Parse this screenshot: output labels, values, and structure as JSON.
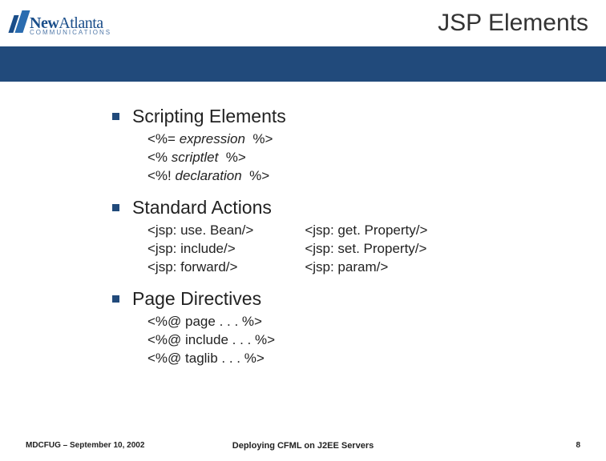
{
  "header": {
    "logo_main_bold": "New",
    "logo_main_light": "Atlanta",
    "logo_sub": "COMMUNICATIONS",
    "title": "JSP Elements"
  },
  "sections": [
    {
      "title": "Scripting Elements",
      "items": [
        {
          "prefix": "<%= ",
          "mid": "expression",
          "suffix": "  %>"
        },
        {
          "prefix": "<% ",
          "mid": "scriptlet",
          "suffix": "  %>"
        },
        {
          "prefix": "<%! ",
          "mid": "declaration",
          "suffix": "  %>"
        }
      ]
    },
    {
      "title": "Standard Actions",
      "col1": [
        "<jsp: use. Bean/>",
        "<jsp: include/>",
        "<jsp: forward/>"
      ],
      "col2": [
        "<jsp: get. Property/>",
        "<jsp: set. Property/>",
        "<jsp: param/>"
      ]
    },
    {
      "title": "Page Directives",
      "lines": [
        "<%@ page . . . %>",
        "<%@ include . . . %>",
        "<%@ taglib . . . %>"
      ]
    }
  ],
  "footer": {
    "left": "MDCFUG – September 10, 2002",
    "center": "Deploying CFML on J2EE Servers",
    "right": "8"
  }
}
